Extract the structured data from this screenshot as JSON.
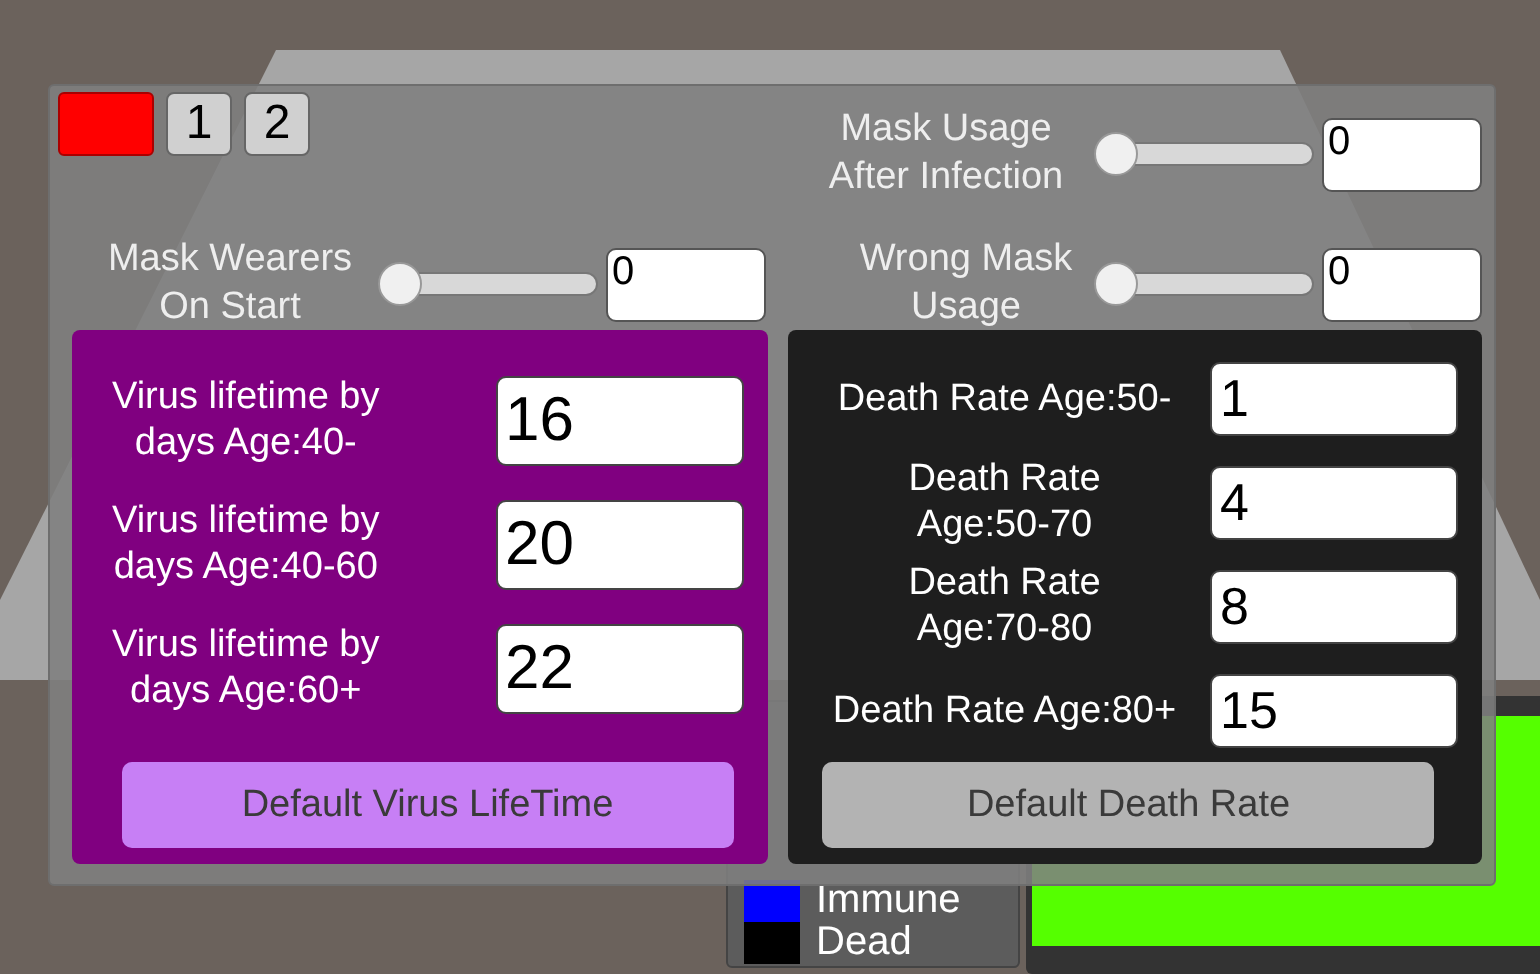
{
  "top_buttons": [
    {
      "label": "1"
    },
    {
      "label": "2"
    }
  ],
  "sliders": [
    {
      "label": "Mask Usage\nAfter Infection",
      "level": 0,
      "value": "0"
    },
    {
      "label": "Mask Wearers\nOn Start",
      "level": 0,
      "value": "0"
    },
    {
      "label": "Wrong Mask\nUsage",
      "level": 0,
      "value": "0"
    }
  ],
  "virus_lifetime": {
    "rows": [
      {
        "label": "Virus lifetime by\ndays Age:40-",
        "value": "16"
      },
      {
        "label": "Virus lifetime by\ndays Age:40-60",
        "value": "20"
      },
      {
        "label": "Virus lifetime by\ndays Age:60+",
        "value": "22"
      }
    ],
    "button": "Default Virus LifeTime"
  },
  "death_rate": {
    "rows": [
      {
        "label": "Death Rate Age:50-",
        "value": "1"
      },
      {
        "label": "Death Rate\nAge:50-70",
        "value": "4"
      },
      {
        "label": "Death Rate\nAge:70-80",
        "value": "8"
      },
      {
        "label": "Death Rate Age:80+",
        "value": "15"
      }
    ],
    "button": "Default Death Rate"
  },
  "legend": [
    {
      "label": "Immune",
      "color": "#0000ff"
    },
    {
      "label": "Dead",
      "color": "#000000"
    }
  ]
}
